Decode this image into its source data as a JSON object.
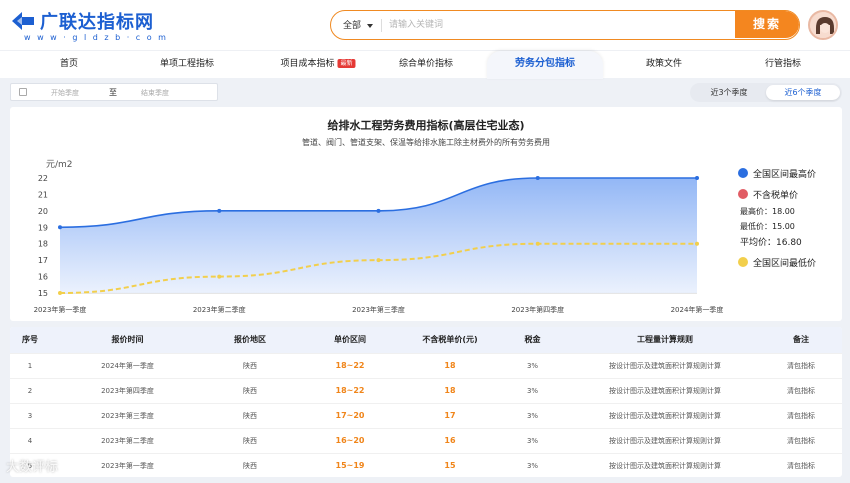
{
  "header": {
    "logo_title": "广联达指标网",
    "logo_url": "w w w · g l d z b · c o m",
    "search_category": "全部",
    "search_placeholder": "请输入关键词",
    "search_button": "搜索"
  },
  "nav": {
    "items": [
      {
        "label": "首页"
      },
      {
        "label": "单项工程指标"
      },
      {
        "label": "项目成本指标",
        "badge": "最新"
      },
      {
        "label": "综合单价指标"
      },
      {
        "label": "劳务分包指标"
      },
      {
        "label": "政策文件"
      },
      {
        "label": "行管指标"
      }
    ]
  },
  "filter": {
    "start_placeholder": "开始季度",
    "to_label": "至",
    "end_placeholder": "结束季度",
    "options": [
      "近3个季度",
      "近6个季度"
    ]
  },
  "chart_data": {
    "type": "area",
    "title": "给排水工程劳务费用指标(高层住宅业态)",
    "subtitle": "管道、阀门、管道支架、保温等给排水施工除主材费外的所有劳务费用",
    "ylabel": "元/m2",
    "categories": [
      "2023年第一季度",
      "2023年第二季度",
      "2023年第三季度",
      "2023年第四季度",
      "2024年第一季度"
    ],
    "ylim": [
      15,
      22
    ],
    "yticks": [
      "15",
      "16",
      "17",
      "18",
      "19",
      "20",
      "21",
      "22"
    ],
    "series": [
      {
        "name": "全国区间最高价",
        "values": [
          19,
          20,
          20,
          22,
          22
        ],
        "color": "#2b6ee0"
      },
      {
        "name": "全国区间最低价",
        "values": [
          15,
          16,
          17,
          18,
          18
        ],
        "color": "#f2cf4c"
      }
    ],
    "legend_mid": {
      "name": "不含税单价",
      "color": "#e15c64",
      "max_label": "最高价：18.00",
      "min_label": "最低价：15.00",
      "avg_label": "平均价：16.80"
    }
  },
  "table": {
    "headers": [
      "序号",
      "报价时间",
      "报价地区",
      "单价区间",
      "不含税单价(元)",
      "税金",
      "工程量计算规则",
      "备注"
    ],
    "rows": [
      [
        "1",
        "2024年第一季度",
        "陕西",
        "18~22",
        "18",
        "3%",
        "按设计图示及建筑面积计算规则计算",
        "清包指标"
      ],
      [
        "2",
        "2023年第四季度",
        "陕西",
        "18~22",
        "18",
        "3%",
        "按设计图示及建筑面积计算规则计算",
        "清包指标"
      ],
      [
        "3",
        "2023年第三季度",
        "陕西",
        "17~20",
        "17",
        "3%",
        "按设计图示及建筑面积计算规则计算",
        "清包指标"
      ],
      [
        "4",
        "2023年第二季度",
        "陕西",
        "16~20",
        "16",
        "3%",
        "按设计图示及建筑面积计算规则计算",
        "清包指标"
      ],
      [
        "5",
        "2023年第一季度",
        "陕西",
        "15~19",
        "15",
        "3%",
        "按设计图示及建筑面积计算规则计算",
        "清包指标"
      ]
    ]
  },
  "watermark": "大数评标"
}
